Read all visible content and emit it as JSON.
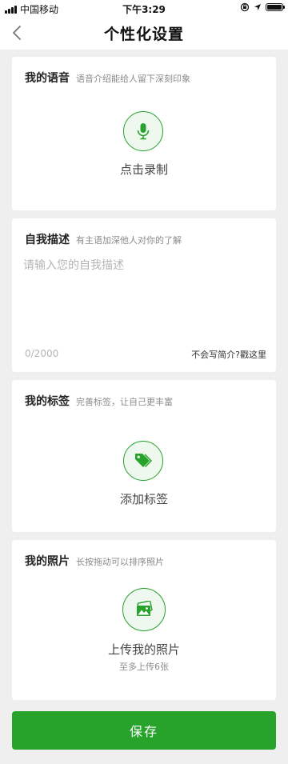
{
  "status_bar": {
    "carrier": "中国移动",
    "time": "下午3:29",
    "icons": [
      "signal-icon",
      "rotation-lock-icon",
      "location-icon",
      "battery-icon"
    ]
  },
  "nav": {
    "title": "个性化设置",
    "back_icon": "chevron-left-icon"
  },
  "voice": {
    "title": "我的语音",
    "hint": "语音介绍能给人留下深刻印象",
    "action_label": "点击录制",
    "icon": "microphone-icon"
  },
  "description": {
    "title": "自我描述",
    "hint": "有主语加深他人对你的了解",
    "placeholder": "请输入您的自我描述",
    "value": "",
    "counter": "0/2000",
    "help_link": "不会写简介?戳这里"
  },
  "tags": {
    "title": "我的标签",
    "hint": "完善标签，让自己更丰富",
    "action_label": "添加标签",
    "icon": "tag-icon"
  },
  "photos": {
    "title": "我的照片",
    "hint": "长按拖动可以排序照片",
    "action_label": "上传我的照片",
    "sub_label": "至多上传6张",
    "icon": "photos-icon"
  },
  "save_button": {
    "label": "保存"
  },
  "colors": {
    "accent": "#27a22b",
    "accent_light": "#eef8ee",
    "background": "#efefef",
    "card": "#ffffff",
    "hint_text": "#8a8a8a",
    "placeholder_text": "#b5b5b5"
  }
}
